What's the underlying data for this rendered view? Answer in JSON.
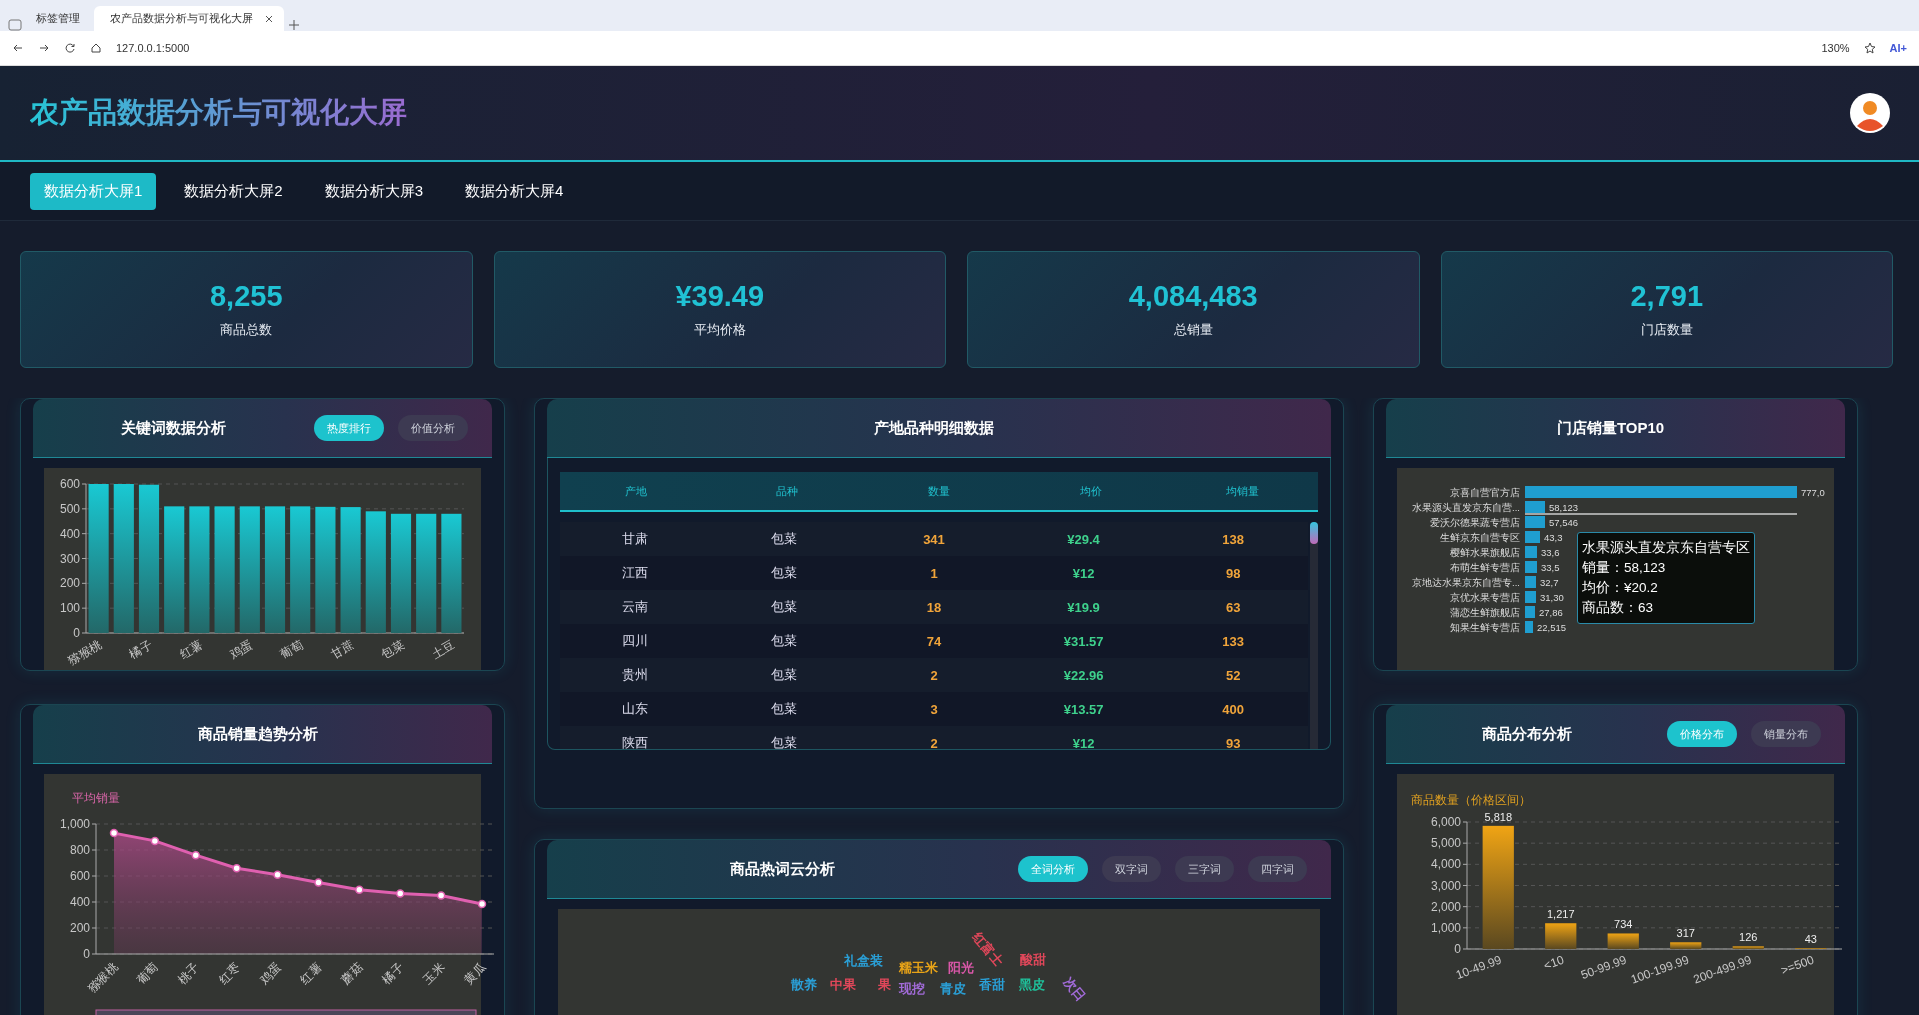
{
  "browser": {
    "tabs": [
      {
        "label": "标签管理",
        "selected": false
      },
      {
        "label": "农产品数据分析与可视化大屏",
        "selected": true
      }
    ],
    "address": "127.0.0.1:5000",
    "zoom": "130%",
    "ai_label": "AI+"
  },
  "header": {
    "title": "农产品数据分析与可视化大屏"
  },
  "nav_tabs": [
    {
      "label": "数据分析大屏1",
      "selected": true
    },
    {
      "label": "数据分析大屏2",
      "selected": false
    },
    {
      "label": "数据分析大屏3",
      "selected": false
    },
    {
      "label": "数据分析大屏4",
      "selected": false
    }
  ],
  "kpis": [
    {
      "value": "8,255",
      "label": "商品总数"
    },
    {
      "value": "¥39.49",
      "label": "平均价格"
    },
    {
      "value": "4,084,483",
      "label": "总销量"
    },
    {
      "value": "2,791",
      "label": "门店数量"
    }
  ],
  "keyword_panel": {
    "title": "关键词数据分析",
    "buttons": [
      {
        "label": "热度排行",
        "selected": true
      },
      {
        "label": "价值分析",
        "selected": false
      }
    ],
    "chart_data": {
      "type": "bar",
      "categories": [
        "猕猴桃",
        null,
        "橘子",
        null,
        "红薯",
        null,
        "鸡蛋",
        null,
        "葡萄",
        null,
        "甘蔗",
        null,
        "包菜",
        null,
        "土豆"
      ],
      "values": [
        600,
        600,
        597,
        510,
        510,
        510,
        510,
        510,
        510,
        508,
        507,
        490,
        480,
        480,
        480
      ],
      "ylim": [
        0,
        600
      ],
      "yticks": [
        0,
        100,
        200,
        300,
        400,
        500,
        600
      ],
      "grid": true
    }
  },
  "trend_panel": {
    "title": "商品销量趋势分析",
    "chart_data": {
      "type": "area",
      "ylabel": "平均销量",
      "categories": [
        "猕猴桃",
        "葡萄",
        "桃子",
        "红枣",
        "鸡蛋",
        "红薯",
        "蘑菇",
        "橘子",
        "玉米",
        "黄瓜"
      ],
      "values": [
        930,
        870,
        760,
        660,
        610,
        550,
        495,
        465,
        450,
        385
      ],
      "ylim": [
        0,
        1000
      ],
      "yticks": [
        0,
        200,
        400,
        600,
        800,
        {
          "value": 1000,
          "label": "1,000"
        }
      ],
      "grid": true
    }
  },
  "table_panel": {
    "title": "产地品种明细数据",
    "columns": [
      "产地",
      "品种",
      "数量",
      "均价",
      "均销量"
    ],
    "rows": [
      [
        "甘肃",
        "包菜",
        "341",
        "¥29.4",
        "138"
      ],
      [
        "江西",
        "包菜",
        "1",
        "¥12",
        "98"
      ],
      [
        "云南",
        "包菜",
        "18",
        "¥19.9",
        "63"
      ],
      [
        "四川",
        "包菜",
        "74",
        "¥31.57",
        "133"
      ],
      [
        "贵州",
        "包菜",
        "2",
        "¥22.96",
        "52"
      ],
      [
        "山东",
        "包菜",
        "3",
        "¥13.57",
        "400"
      ],
      [
        "陕西",
        "包菜",
        "2",
        "¥12",
        "93"
      ]
    ]
  },
  "wordcloud_panel": {
    "title": "商品热词云分析",
    "buttons": [
      {
        "label": "全词分析",
        "selected": true
      },
      {
        "label": "双字词",
        "selected": false
      },
      {
        "label": "三字词",
        "selected": false
      },
      {
        "label": "四字词",
        "selected": false
      }
    ],
    "words": [
      {
        "text": "礼盒装",
        "color": "#2a9fd6",
        "rotated": false
      },
      {
        "text": "糯玉米",
        "color": "#e8a317",
        "rotated": false
      },
      {
        "text": "阳光",
        "color": "#d957a8",
        "rotated": false
      },
      {
        "text": "红富士",
        "color": "#e0475a",
        "rotated": true
      },
      {
        "text": "酸甜",
        "color": "#e0475a",
        "rotated": false
      },
      {
        "text": "散养",
        "color": "#2a9fd6",
        "rotated": false
      },
      {
        "text": "中果",
        "color": "#e0475a",
        "rotated": false
      },
      {
        "text": "果",
        "color": "#e0475a",
        "rotated": false
      },
      {
        "text": "现挖",
        "color": "#a26bd9",
        "rotated": false
      },
      {
        "text": "青皮",
        "color": "#2a9fd6",
        "rotated": false
      },
      {
        "text": "香甜",
        "color": "#2a9fd6",
        "rotated": false
      },
      {
        "text": "黑皮",
        "color": "#1fbf9a",
        "rotated": false
      },
      {
        "text": "次日",
        "color": "#a26bd9",
        "rotated": true
      }
    ]
  },
  "top10_panel": {
    "title": "门店销量TOP10",
    "stores": [
      {
        "name": "京喜自营官方店",
        "sales": "777,0"
      },
      {
        "name": "水果源头直发京东自营...",
        "sales": "58,123"
      },
      {
        "name": "爱沃尔德果蔬专营店",
        "sales": "57,546"
      },
      {
        "name": "生鲜京东自营专区",
        "sales": "43,3"
      },
      {
        "name": "樱鲜水果旗舰店",
        "sales": "33,6"
      },
      {
        "name": "布萌生鲜专营店",
        "sales": "33,5"
      },
      {
        "name": "京地达水果京东自营专...",
        "sales": "32,7"
      },
      {
        "name": "京优水果专营店",
        "sales": "31,30"
      },
      {
        "name": "蒲恋生鲜旗舰店",
        "sales": "27,86"
      },
      {
        "name": "知果生鲜专营店",
        "sales": "22,515"
      }
    ],
    "tooltip": {
      "title": "水果源头直发京东自营专区",
      "lines": [
        "销量：58,123",
        "均价：¥20.2",
        "商品数：63"
      ]
    }
  },
  "distribution_panel": {
    "title": "商品分布分析",
    "buttons": [
      {
        "label": "价格分布",
        "selected": true
      },
      {
        "label": "销量分布",
        "selected": false
      }
    ],
    "chart_data": {
      "type": "bar",
      "ylabel": "商品数量（价格区间）",
      "categories": [
        "10-49.99",
        "<10",
        "50-99.99",
        "100-199.99",
        "200-499.99",
        ">=500"
      ],
      "values": [
        5818,
        1217,
        734,
        317,
        126,
        43
      ],
      "value_labels": [
        "5,818",
        "1,217",
        "734",
        "317",
        "126",
        "43"
      ],
      "grid": true,
      "ylim": [
        0,
        6000
      ],
      "yticks": [
        0,
        {
          "value": 1000,
          "label": "1,000"
        },
        {
          "value": 2000,
          "label": "2,000"
        },
        {
          "value": 3000,
          "label": "3,000"
        },
        {
          "value": 4000,
          "label": "4,000"
        },
        {
          "value": 5000,
          "label": "5,000"
        },
        {
          "value": 6000,
          "label": "6,000"
        }
      ]
    }
  }
}
